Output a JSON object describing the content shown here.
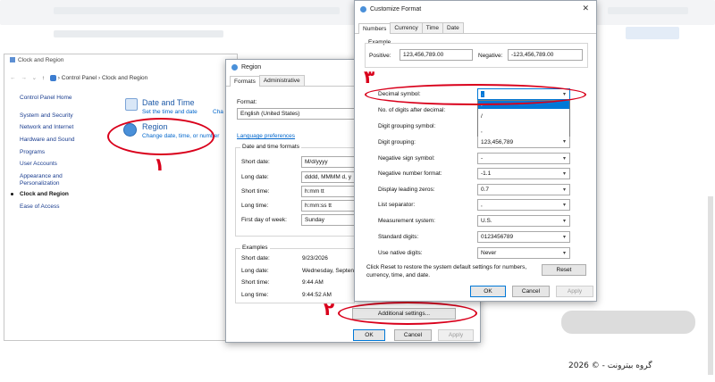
{
  "control_panel": {
    "title": "Clock and Region",
    "breadcrumb": [
      "Control Panel",
      "Clock and Region"
    ],
    "sidebar": [
      {
        "label": "Control Panel Home",
        "current": false
      },
      {
        "label": "System and Security",
        "current": false
      },
      {
        "label": "Network and Internet",
        "current": false
      },
      {
        "label": "Hardware and Sound",
        "current": false
      },
      {
        "label": "Programs",
        "current": false
      },
      {
        "label": "User Accounts",
        "current": false
      },
      {
        "label": "Appearance and",
        "current": false
      },
      {
        "label": "Personalization",
        "current": false
      },
      {
        "label": "Clock and Region",
        "current": true
      },
      {
        "label": "Ease of Access",
        "current": false
      }
    ],
    "date_time": {
      "title": "Date and Time",
      "link1": "Set the time and date",
      "link2": "Cha"
    },
    "region": {
      "title": "Region",
      "link": "Change date, time, or number"
    }
  },
  "region_dialog": {
    "title": "Region",
    "tabs": [
      "Formats",
      "Administrative"
    ],
    "format_label": "Format:",
    "format_value": "English (United States)",
    "language_link": "Language preferences",
    "dt_group": "Date and time formats",
    "rows": [
      {
        "label": "Short date:",
        "value": "M/d/yyyy"
      },
      {
        "label": "Long date:",
        "value": "dddd, MMMM d, y"
      },
      {
        "label": "Short time:",
        "value": "h:mm tt"
      },
      {
        "label": "Long time:",
        "value": "h:mm:ss tt"
      },
      {
        "label": "First day of week:",
        "value": "Sunday"
      }
    ],
    "examples_group": "Examples",
    "examples": [
      {
        "label": "Short date:",
        "value": "9/23/2026"
      },
      {
        "label": "Long date:",
        "value": "Wednesday, Septen"
      },
      {
        "label": "Short time:",
        "value": "9:44 AM"
      },
      {
        "label": "Long time:",
        "value": "9:44:52 AM"
      }
    ],
    "additional_btn": "Additional settings...",
    "ok": "OK",
    "cancel": "Cancel",
    "apply": "Apply"
  },
  "customize_dialog": {
    "title": "Customize Format",
    "tabs": [
      "Numbers",
      "Currency",
      "Time",
      "Date"
    ],
    "example_label": "Example",
    "positive_label": "Positive:",
    "positive_value": "123,456,789.00",
    "negative_label": "Negative:",
    "negative_value": "-123,456,789.00",
    "settings": [
      {
        "label": "Decimal symbol:",
        "value": "."
      },
      {
        "label": "No. of digits after decimal:",
        "value": ""
      },
      {
        "label": "Digit grouping symbol:",
        "value": ""
      },
      {
        "label": "Digit grouping:",
        "value": "123,456,789"
      },
      {
        "label": "Negative sign symbol:",
        "value": "-"
      },
      {
        "label": "Negative number format:",
        "value": "-1.1"
      },
      {
        "label": "Display leading zeros:",
        "value": "0.7"
      },
      {
        "label": "List separator:",
        "value": ","
      },
      {
        "label": "Measurement system:",
        "value": "U.S."
      },
      {
        "label": "Standard digits:",
        "value": "0123456789"
      },
      {
        "label": "Use native digits:",
        "value": "Never"
      }
    ],
    "dropdown_options": [
      ".",
      "/",
      ","
    ],
    "reset_text": "Click Reset to restore the system default settings for numbers, currency, time, and date.",
    "reset_btn": "Reset",
    "ok": "OK",
    "cancel": "Cancel",
    "apply": "Apply"
  },
  "annotations": {
    "one": "١",
    "two": "٢",
    "three": "٣"
  },
  "footer": "گروه بیترونت - © 2026",
  "colors": {
    "annotation_red": "#d9001b",
    "link_blue": "#0066cc",
    "selection_blue": "#0078d7"
  }
}
